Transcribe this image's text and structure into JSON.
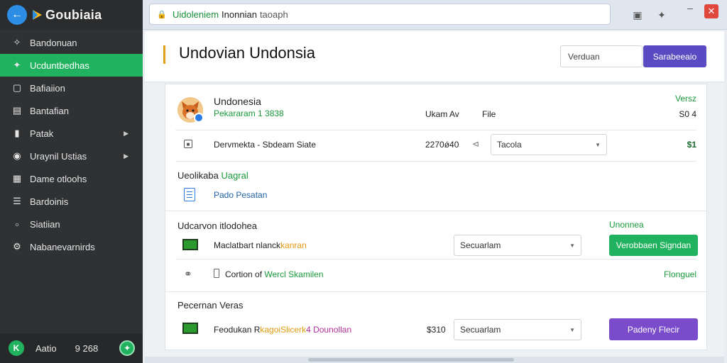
{
  "app": {
    "title": "Goubiaia"
  },
  "sidebar": {
    "items": [
      {
        "label": "Bandonuan",
        "icon": "settings-icon",
        "active": false
      },
      {
        "label": "Ucduntbedhas",
        "icon": "puzzle-icon",
        "active": true
      },
      {
        "label": "Bafiaiion",
        "icon": "chat-icon",
        "active": false
      },
      {
        "label": "Bantafian",
        "icon": "document-icon",
        "active": false
      },
      {
        "label": "Patak",
        "icon": "bookmark-icon",
        "active": false,
        "has_arrow": true
      },
      {
        "label": "Uraynil Ustias",
        "icon": "shield-icon",
        "active": false,
        "has_arrow": true
      },
      {
        "label": "Dame otloohs",
        "icon": "chart-icon",
        "active": false
      },
      {
        "label": "Bardoinis",
        "icon": "list-icon",
        "active": false
      },
      {
        "label": "Siatiian",
        "icon": "file-icon",
        "active": false
      },
      {
        "label": "Nabanevarnirds",
        "icon": "gear-icon",
        "active": false
      }
    ],
    "footer": {
      "badge": "K",
      "label": "Aatio",
      "count": "9 268"
    }
  },
  "topbar": {
    "url_green": "Uidoleniem",
    "url_dark": "Inonnian",
    "url_gray": "taoaph"
  },
  "header": {
    "title": "Undovian Undonsia",
    "search_value": "Verduan",
    "primary_button": "Sarabeeaio"
  },
  "profile": {
    "name": "Undonesia",
    "subtitle": "Pekararam 1 3838",
    "col_a": "Ukam Av",
    "col_b": "File",
    "right_top": "Versz",
    "right_bottom": "S0 4"
  },
  "detail_row": {
    "label": "Dervmekta -  Sbdeam Siate",
    "value": "2270ǿ40",
    "select_value": "Tacola",
    "amount": "$1"
  },
  "section_one": {
    "heading_dark": "Ueolikaba",
    "heading_green": "Uagral",
    "link": "Pado Pesatan"
  },
  "section_two": {
    "heading": "Udcarvon itlodohea",
    "status": "Unonnea",
    "item_dark": "Maclatbart nlanck",
    "item_orange": "kanran",
    "select_value": "Secuarlam",
    "button": "Verobbaen Signdan"
  },
  "link_row": {
    "text_dark": "Cortion of",
    "text_green": "Wercl Skamilen",
    "right": "Flonguel"
  },
  "section_three": {
    "heading": "Pecernan Veras",
    "item_dark": "Feodukan R",
    "item_orange": "kagoiSlicerk",
    "item_magenta": "4 Dounollan",
    "amount": "$310",
    "select_value": "Secuarlam",
    "button": "Padeny Flecir"
  },
  "colors": {
    "accent_green": "#21b25f",
    "accent_purple": "#5a4bc2",
    "sidebar_bg": "#2f3133"
  }
}
